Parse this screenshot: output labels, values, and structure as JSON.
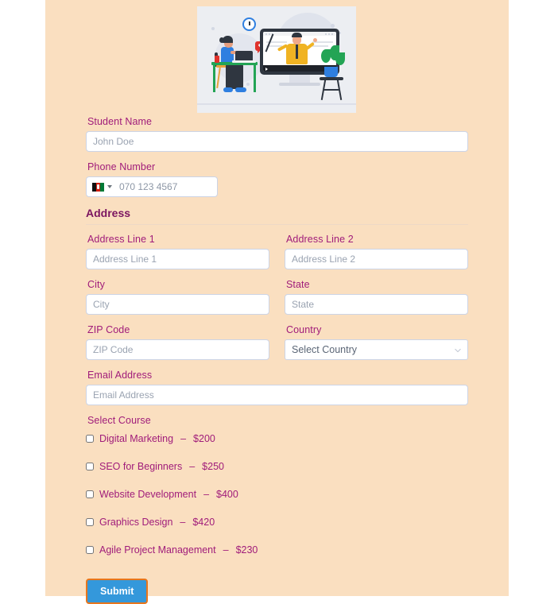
{
  "hero": {
    "alt": "online-learning-illustration"
  },
  "form": {
    "student_name": {
      "label": "Student Name",
      "placeholder": "John Doe",
      "value": ""
    },
    "phone": {
      "label": "Phone Number",
      "placeholder": "070 123 4567",
      "value": "",
      "country_flag": "afghanistan-flag"
    },
    "address_section": {
      "title": "Address",
      "address_line_1": {
        "label": "Address Line 1",
        "placeholder": "Address Line 1",
        "value": ""
      },
      "address_line_2": {
        "label": "Address Line 2",
        "placeholder": "Address Line 2",
        "value": ""
      },
      "city": {
        "label": "City",
        "placeholder": "City",
        "value": ""
      },
      "state": {
        "label": "State",
        "placeholder": "State",
        "value": ""
      },
      "zip": {
        "label": "ZIP Code",
        "placeholder": "ZIP Code",
        "value": ""
      },
      "country": {
        "label": "Country",
        "selected": "Select Country",
        "options": [
          "Select Country"
        ]
      }
    },
    "email": {
      "label": "Email Address",
      "placeholder": "Email Address",
      "value": ""
    },
    "courses": {
      "label": "Select Course",
      "separator": "–",
      "items": [
        {
          "name": "Digital Marketing",
          "price": "$200",
          "checked": false
        },
        {
          "name": "SEO for Beginners",
          "price": "$250",
          "checked": false
        },
        {
          "name": "Website Development",
          "price": "$400",
          "checked": false
        },
        {
          "name": "Graphics Design",
          "price": "$420",
          "checked": false
        },
        {
          "name": "Agile Project Management",
          "price": "$230",
          "checked": false
        }
      ]
    },
    "submit_label": "Submit"
  },
  "colors": {
    "panel_background": "#fadfc0",
    "label": "#a01c7a",
    "section_title": "#7b1560",
    "submit_background": "#3498db",
    "submit_border": "#e8761c",
    "field_border": "#ccd4e6"
  }
}
